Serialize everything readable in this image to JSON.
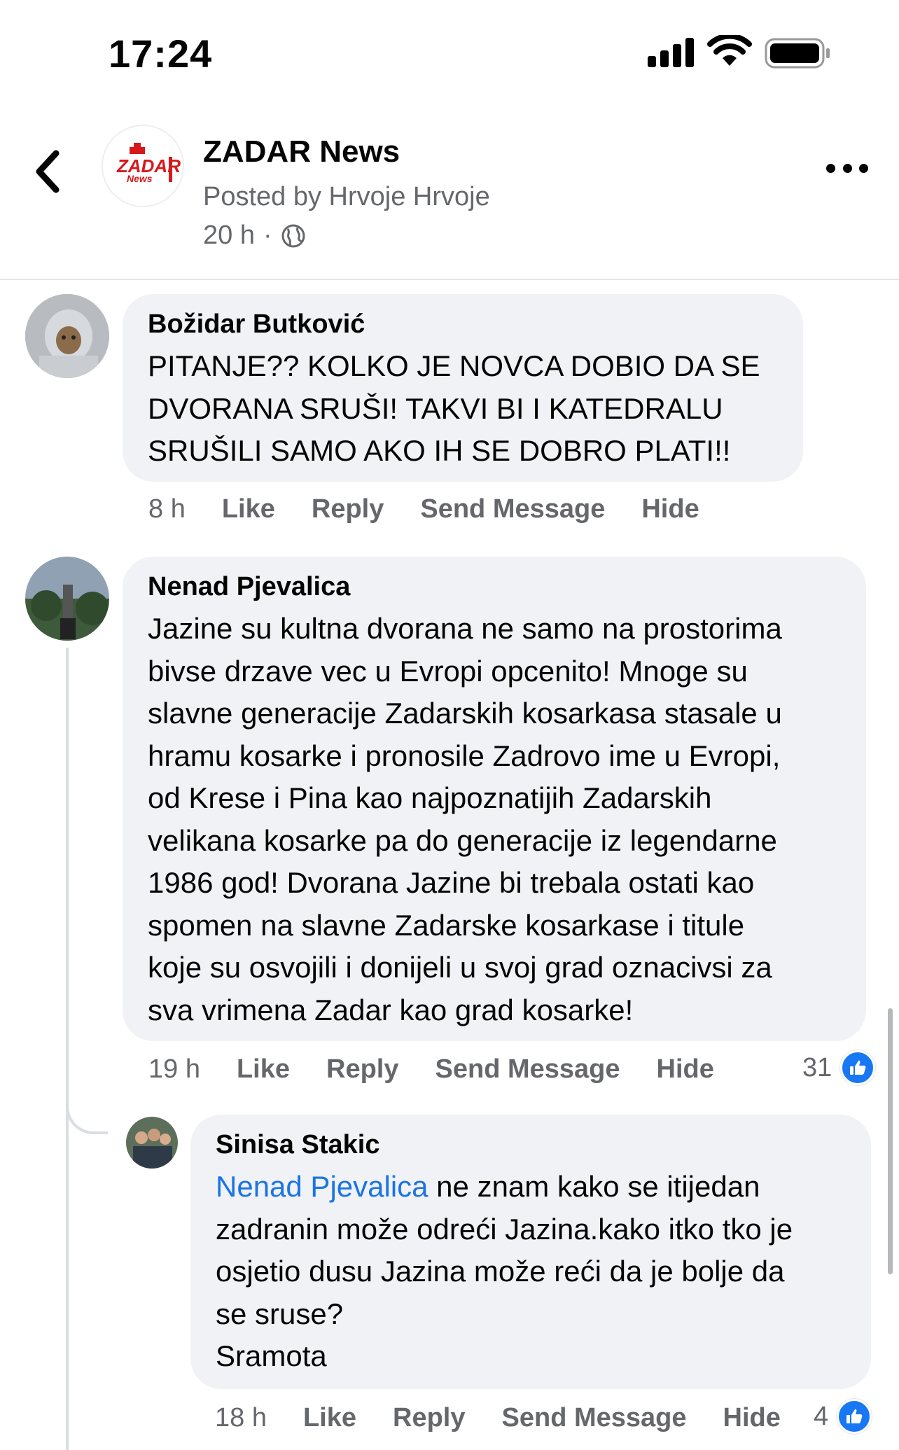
{
  "status": {
    "time": "17:24"
  },
  "header": {
    "page_name": "ZADAR News",
    "posted_by": "Posted by Hrvoje Hrvoje",
    "time": "20 h",
    "dot": "·",
    "logo_text": "ZADAR",
    "logo_sub": "News"
  },
  "comments": [
    {
      "author": "Božidar Butković",
      "text": "PITANJE?? KOLKO JE NOVCA DOBIO DA SE\nDVORANA SRUŠI! TAKVI BI I KATEDRALU\nSRUŠILI SAMO AKO IH SE DOBRO PLATI!!",
      "time": "8 h",
      "like": "Like",
      "reply": "Reply",
      "send": "Send Message",
      "hide": "Hide"
    },
    {
      "author": "Nenad Pjevalica",
      "text": "Jazine su kultna dvorana ne samo na prostorima\nbivse drzave vec u Evropi opcenito! Mnoge su\nslavne generacije Zadarskih kosarkasa stasale u\nhramu kosarke i pronosile Zadrovo ime u Evropi,\nod Krese i Pina kao najpoznatijih Zadarskih\nvelikana kosarke pa do generacije iz legendarne\n1986 god! Dvorana Jazine bi trebala ostati kao\nspomen na slavne Zadarske kosarkase i titule\nkoje su osvojili i donijeli u svoj grad oznacivsi za\nsva vrimena Zadar kao grad kosarke!",
      "time": "19 h",
      "like": "Like",
      "reply": "Reply",
      "send": "Send Message",
      "hide": "Hide",
      "reactions": "31"
    },
    {
      "author": "Sinisa Stakic",
      "mention": "Nenad Pjevalica",
      "text": " ne znam kako se itijedan\nzadranin može odreći Jazina.kako itko tko je\nosjetio dusu Jazina može reći da je bolje da\nse sruse?\nSramota",
      "time": "18 h",
      "like": "Like",
      "reply": "Reply",
      "send": "Send Message",
      "hide": "Hide",
      "reactions": "4"
    }
  ],
  "colors": {
    "link": "#1b74e4",
    "like": "#1877f2",
    "bubble": "#f0f2f5",
    "meta": "#65676b"
  }
}
